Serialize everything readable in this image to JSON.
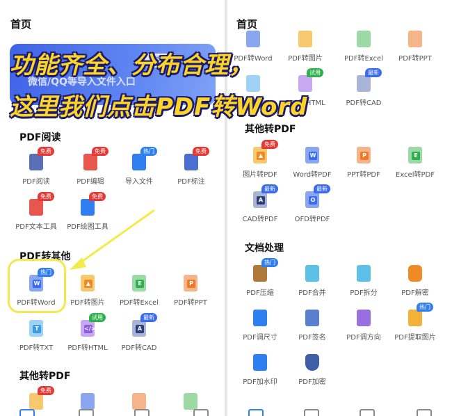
{
  "left": {
    "title": "首页",
    "banner": {
      "button": "导入",
      "text": "微信/QQ等导入文件入口"
    },
    "sections": [
      {
        "title": "PDF阅读"
      },
      {
        "title": "PDF转其他"
      },
      {
        "title": "其他转PDF"
      }
    ],
    "pdf_read": [
      {
        "label": "PDF阅读",
        "badge": "免费"
      },
      {
        "label": "PDF编辑",
        "badge": "免费"
      },
      {
        "label": "导入文件",
        "badge": "热门"
      },
      {
        "label": "PDF标注",
        "badge": "免费"
      },
      {
        "label": "PDF文本工具",
        "badge": "免费"
      },
      {
        "label": "PDF绘图工具",
        "badge": "免费"
      }
    ],
    "pdf_to_other": [
      {
        "label": "PDF转Word",
        "badge": "热门"
      },
      {
        "label": "PDF转图片",
        "badge": ""
      },
      {
        "label": "PDF转Excel",
        "badge": ""
      },
      {
        "label": "PDF转PPT",
        "badge": ""
      },
      {
        "label": "PDF转TXT",
        "badge": ""
      },
      {
        "label": "PDF转HTML",
        "badge": "试用"
      },
      {
        "label": "PDF转CAD",
        "badge": "最新"
      }
    ],
    "other_to_pdf_badges": [
      "免费"
    ]
  },
  "right": {
    "title": "首页",
    "top_row": [
      {
        "label": "PDF转Word",
        "badge": ""
      },
      {
        "label": "PDF转图片",
        "badge": ""
      },
      {
        "label": "PDF转Excel",
        "badge": ""
      },
      {
        "label": "PDF转PPT",
        "badge": ""
      },
      {
        "label": "PDF转TXT",
        "badge": ""
      },
      {
        "label": "PDF转HTML",
        "badge": "试用"
      },
      {
        "label": "PDF转CAD",
        "badge": "最新"
      }
    ],
    "sections": [
      {
        "title": "其他转PDF"
      },
      {
        "title": "文档处理"
      }
    ],
    "other_to_pdf": [
      {
        "label": "图片转PDF",
        "badge": "免费"
      },
      {
        "label": "Word转PDF",
        "badge": ""
      },
      {
        "label": "PPT转PDF",
        "badge": ""
      },
      {
        "label": "Excel转PDF",
        "badge": ""
      },
      {
        "label": "CAD转PDF",
        "badge": "最新"
      },
      {
        "label": "OFD转PDF",
        "badge": "最新"
      }
    ],
    "doc_process": [
      {
        "label": "PDF压缩",
        "badge": "热门"
      },
      {
        "label": "PDF合并",
        "badge": ""
      },
      {
        "label": "PDF拆分",
        "badge": ""
      },
      {
        "label": "PDF解密",
        "badge": ""
      },
      {
        "label": "PDF调尺寸",
        "badge": ""
      },
      {
        "label": "PDF签名",
        "badge": ""
      },
      {
        "label": "PDF调方向",
        "badge": ""
      },
      {
        "label": "PDF提取图片",
        "badge": "热门"
      },
      {
        "label": "PDF加水印",
        "badge": ""
      },
      {
        "label": "PDF加密",
        "badge": ""
      }
    ]
  },
  "overlay": {
    "line1": "功能齐全、分布合理，",
    "line2": "这里我们点击PDF转Word"
  },
  "colors": {
    "red": "#e53935",
    "blue": "#2f7ff0",
    "green": "#2fb24c",
    "orange": "#f08a24",
    "yellow": "#ffd428"
  }
}
